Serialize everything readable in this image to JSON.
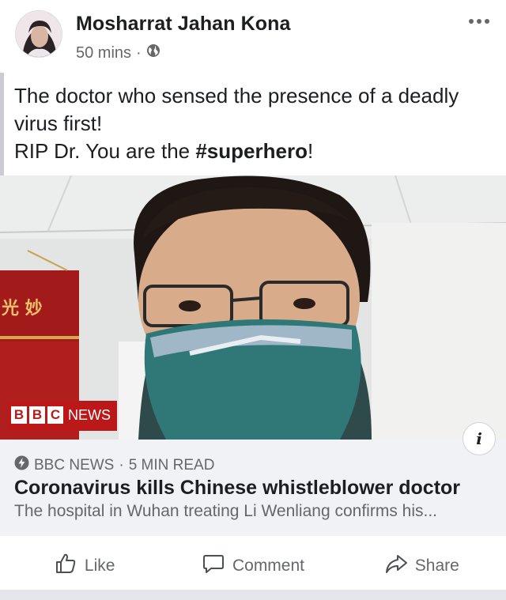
{
  "post": {
    "author": "Mosharrat Jahan Kona",
    "timestamp": "50 mins",
    "separator": "·",
    "audience_icon": "globe-icon",
    "text_lines": [
      "The doctor who sensed the presence of a deadly",
      "virus first!"
    ],
    "text_line3_prefix": "RIP Dr. You are the ",
    "hashtag": "#superhero",
    "text_line3_suffix": "!"
  },
  "image": {
    "logo_blocks": [
      "B",
      "B",
      "C"
    ],
    "logo_word": "NEWS",
    "banner_chars": "光 妙"
  },
  "link_preview": {
    "source": "BBC NEWS",
    "separator": "·",
    "read_time": "5 MIN READ",
    "headline": "Coronavirus kills Chinese whistleblower doctor",
    "description": "The hospital in Wuhan treating Li Wenliang confirms his...",
    "info_label": "i"
  },
  "actions": {
    "like": "Like",
    "comment": "Comment",
    "share": "Share"
  },
  "colors": {
    "text": "#1c1e21",
    "muted": "#65676b",
    "preview_bg": "#f0f2f5",
    "bbc_red": "#bb1919"
  }
}
